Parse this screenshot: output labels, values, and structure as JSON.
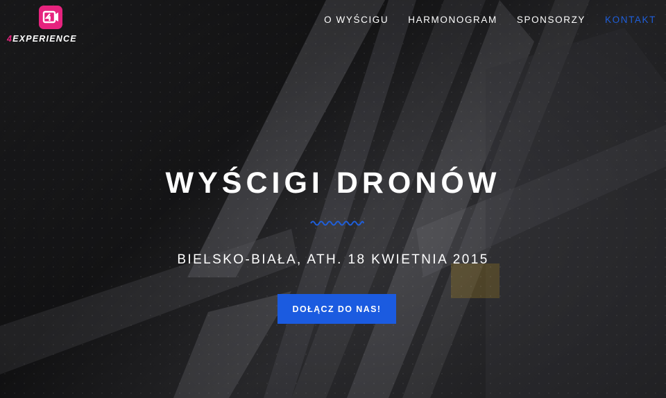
{
  "brand": {
    "logo_text_accent": "4",
    "logo_text_rest": "EXPERIENCE",
    "logo_icon": "camera-4-icon",
    "accent_color": "#e6237e"
  },
  "nav": {
    "items": [
      {
        "label": "O WYŚCIGU"
      },
      {
        "label": "HARMONOGRAM"
      },
      {
        "label": "SPONSORZY"
      },
      {
        "label": "KONTAKT",
        "active": true
      }
    ],
    "active_color": "#1f5fdb"
  },
  "hero": {
    "title": "WYŚCIGI DRONÓW",
    "subtitle": "BIELSKO-BIAŁA, ATH. 18 KWIETNIA 2015",
    "cta_label": "DOŁĄCZ DO NAS!",
    "cta_color": "#1b5be0",
    "divider_icon": "wave-divider-icon"
  }
}
